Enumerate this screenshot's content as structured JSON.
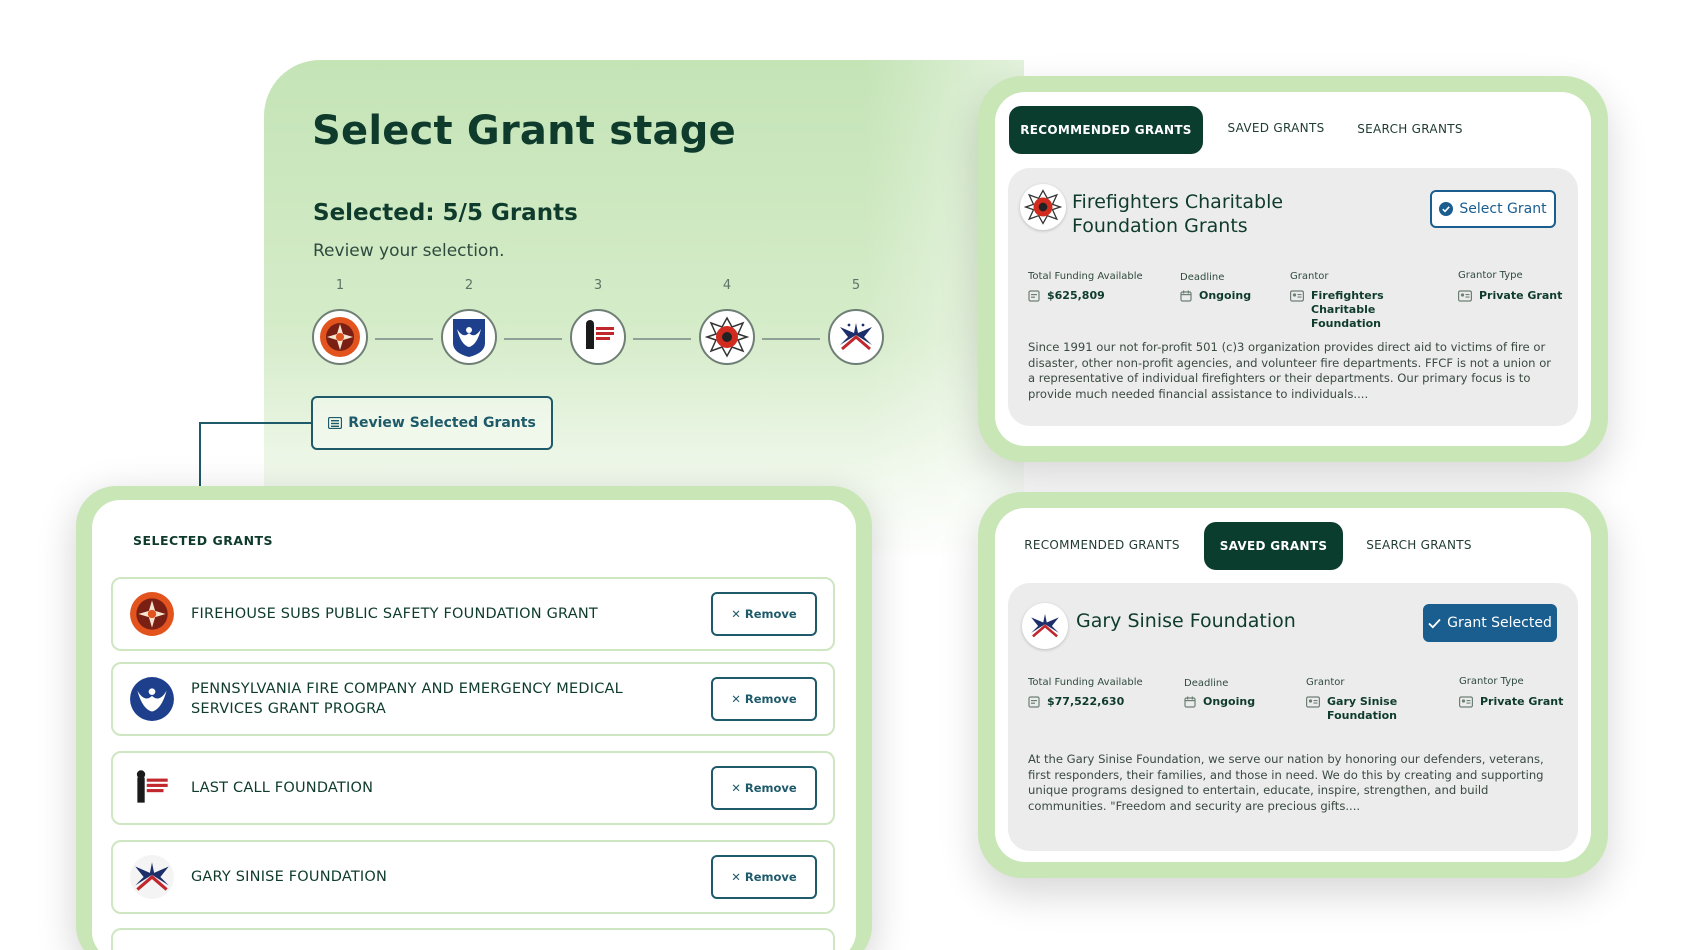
{
  "stage": {
    "title": "Select Grant stage",
    "selected_count": "Selected: 5/5 Grants",
    "subtitle": "Review your selection.",
    "steps": [
      "1",
      "2",
      "3",
      "4",
      "5"
    ],
    "review_button": "Review Selected Grants"
  },
  "selected_panel": {
    "heading": "SELECTED GRANTS",
    "remove_label": "✕ Remove",
    "items": [
      {
        "name": "FIREHOUSE SUBS PUBLIC SAFETY FOUNDATION GRANT"
      },
      {
        "name": "PENNSYLVANIA FIRE COMPANY AND EMERGENCY MEDICAL SERVICES GRANT PROGRA"
      },
      {
        "name": "LAST CALL FOUNDATION",
        "logo_text": "LAST CALL FOUNDATION"
      },
      {
        "name": "GARY SINISE FOUNDATION"
      }
    ]
  },
  "card_top": {
    "tabs": [
      "RECOMMENDED GRANTS",
      "SAVED GRANTS",
      "SEARCH GRANTS"
    ],
    "active_tab": 0,
    "title": "Firefighters Charitable Foundation Grants",
    "button": "Select Grant",
    "labels": {
      "funding": "Total Funding Available",
      "deadline": "Deadline",
      "grantor": "Grantor",
      "grantor_type": "Grantor Type"
    },
    "values": {
      "funding": "$625,809",
      "deadline": "Ongoing",
      "grantor": "Firefighters Charitable Foundation",
      "grantor_type": "Private Grant"
    },
    "description": "Since 1991 our not for-profit 501 (c)3 organization provides direct aid to victims of fire or disaster, other non-profit agencies, and volunteer fire departments. FFCF is not a union or a representative of individual firefighters or their departments. Our primary focus is to provide much needed financial assistance to individuals...."
  },
  "card_bottom": {
    "tabs": [
      "RECOMMENDED GRANTS",
      "SAVED GRANTS",
      "SEARCH GRANTS"
    ],
    "active_tab": 1,
    "title": "Gary Sinise Foundation",
    "button": "Grant Selected",
    "labels": {
      "funding": "Total Funding Available",
      "deadline": "Deadline",
      "grantor": "Grantor",
      "grantor_type": "Grantor Type"
    },
    "values": {
      "funding": "$77,522,630",
      "deadline": "Ongoing",
      "grantor": "Gary Sinise Foundation",
      "grantor_type": "Private Grant"
    },
    "description": "At the Gary Sinise Foundation, we serve our nation by honoring our defenders, veterans, first responders, their families, and those in need. We do this by creating and supporting unique programs designed to entertain, educate, inspire, strengthen, and build communities. \"Freedom and security are precious gifts...."
  },
  "colors": {
    "primary_dark": "#0b3d2e",
    "accent_blue": "#1a5d8f",
    "outline_teal": "#1e5a6a",
    "panel_green": "#c8e6b6"
  },
  "icons": [
    "firehouse-subs-logo",
    "pennsylvania-eagle-logo",
    "last-call-logo",
    "fire-dept-maltese-logo",
    "gary-sinise-eagle-logo",
    "list-icon",
    "check-circle-icon",
    "checkmark-icon",
    "document-icon",
    "calendar-icon",
    "id-card-icon"
  ]
}
